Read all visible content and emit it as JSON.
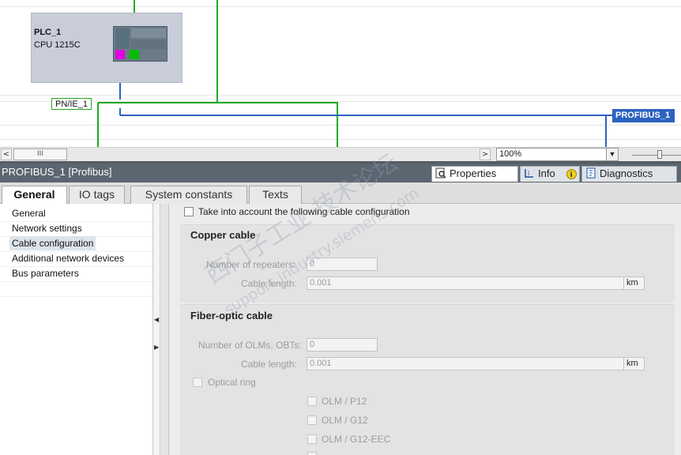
{
  "network": {
    "plc_name": "PLC_1",
    "plc_type": "CPU 1215C",
    "pn_subnet": "PN/IE_1",
    "pb_subnet": "PROFIBUS_1",
    "colors": {
      "profinet": "#22aa22",
      "profibus": "#2e62c0",
      "dp_port": "#e000e0",
      "pn_port": "#00c000"
    }
  },
  "toolbar": {
    "scroll_left": "<",
    "scroll_right": ">",
    "scroll_thumb": "III",
    "zoom_value": "100%",
    "zoom_dropdown": "▼"
  },
  "inspector": {
    "title": "PROFIBUS_1 [Profibus]",
    "tabs": [
      {
        "label": "Properties",
        "icon": "properties-icon"
      },
      {
        "label": "Info",
        "icon": "info-icon"
      },
      {
        "label": "Diagnostics",
        "icon": "diagnostics-icon"
      }
    ]
  },
  "tabs": [
    "General",
    "IO tags",
    "System constants",
    "Texts"
  ],
  "nav": [
    "General",
    "Network settings",
    "Cable configuration",
    "Additional network devices",
    "Bus parameters"
  ],
  "main": {
    "take_into_account": "Take into account the following cable configuration",
    "copper": {
      "title": "Copper cable",
      "repeaters_label": "Number of repeaters:",
      "repeaters_value": "0",
      "length_label": "Cable length:",
      "length_value": "0.001",
      "unit": "km"
    },
    "fiber": {
      "title": "Fiber-optic cable",
      "olms_label": "Number of OLMs, OBTs:",
      "olms_value": "0",
      "length_label": "Cable length:",
      "length_value": "0.001",
      "unit": "km",
      "optical_ring": "Optical ring",
      "options": [
        "OLM / P12",
        "OLM / G12",
        "OLM / G12-EEC"
      ]
    }
  },
  "watermark": {
    "line1": "西门子工业 技术论坛",
    "line2": "support.industry.siemens.com"
  }
}
